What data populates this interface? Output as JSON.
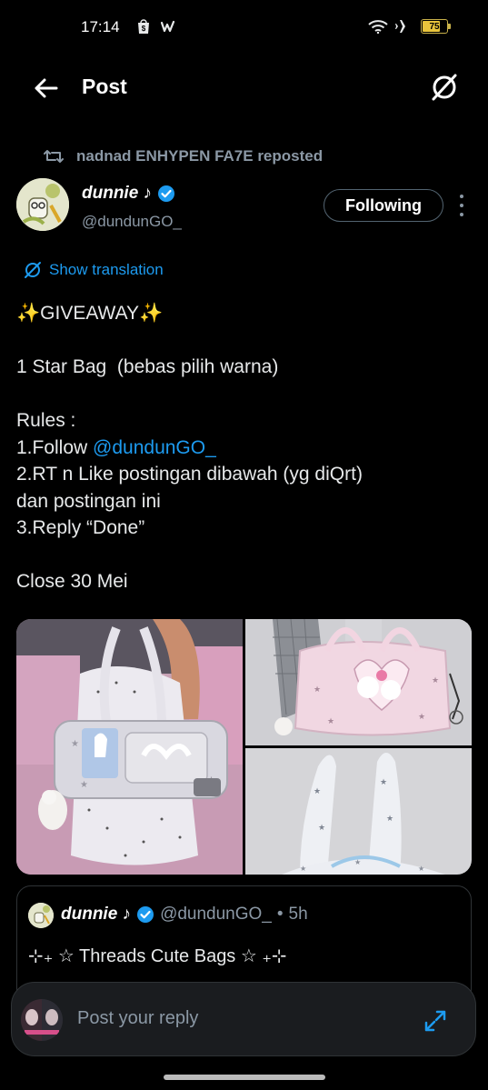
{
  "status_bar": {
    "time": "17:14",
    "battery": "75",
    "icons": [
      "shop-icon",
      "w-app-icon",
      "wifi-icon",
      "airplane-icon",
      "battery-icon"
    ]
  },
  "header": {
    "title": "Post",
    "back_icon": "arrow-left-icon",
    "translate_icon": "translate-slash-icon"
  },
  "post": {
    "repost_text": "nadnad ENHYPEN FA7E reposted",
    "author_name": "dunnie ♪",
    "author_handle": "@dundunGO_",
    "verified": true,
    "follow_label": "Following",
    "show_translation": "Show translation",
    "body": {
      "line1": "✨GIVEAWAY✨",
      "line2": "1 Star Bag  (bebas pilih warna)",
      "line3": "Rules :",
      "line4_prefix": "1.Follow ",
      "line4_mention": "@dundunGO_",
      "line5": "2.RT n Like postingan dibawah (yg diQrt)",
      "line6": "dan postingan ini",
      "line7": "3.Reply “Done”",
      "line8": "Close 30 Mei"
    },
    "media": [
      "bag-photo-1",
      "bag-photo-2",
      "bag-photo-3"
    ]
  },
  "quote": {
    "author_name": "dunnie ♪",
    "author_handle": "@dundunGO_",
    "time": "5h",
    "separator": "•",
    "text": "⊹₊ ☆ Threads Cute Bags ☆ ₊⊹"
  },
  "reply": {
    "placeholder": "Post your reply"
  },
  "colors": {
    "accent": "#1d9bf0",
    "background": "#000000",
    "muted": "#8b98a5",
    "border": "#2f3336"
  }
}
